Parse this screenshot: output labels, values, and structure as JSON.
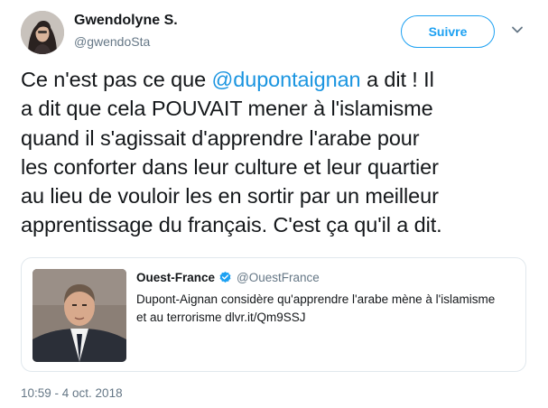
{
  "user": {
    "display_name": "Gwendolyne S.",
    "handle": "@gwendoSta",
    "follow_label": "Suivre"
  },
  "tweet": {
    "line1_before": "Ce n'est pas ce que ",
    "mention": "@dupontaignan",
    "line1_after": " a dit ! Il",
    "line2": "a dit que cela POUVAIT mener à l'islamisme",
    "line3": "quand il s'agissait d'apprendre l'arabe pour",
    "line4": "les conforter dans leur culture et leur quartier",
    "line5": "au lieu de vouloir les en sortir par un meilleur",
    "line6": "apprentissage du français. C'est ça qu'il a dit.",
    "timestamp": "10:59 - 4 oct. 2018"
  },
  "quoted": {
    "name": "Ouest-France",
    "handle": "@OuestFrance",
    "text_line1": "Dupont-Aignan considère qu'apprendre l'arabe mène à l'islamisme",
    "text_line2": "et au terrorisme dlvr.it/Qm9SSJ"
  },
  "colors": {
    "accent": "#1da1f2",
    "mention": "#1b95e0",
    "secondary_text": "#657786",
    "border": "#e1e8ed"
  },
  "icons": [
    "chevron-down-icon",
    "verified-badge-icon"
  ]
}
